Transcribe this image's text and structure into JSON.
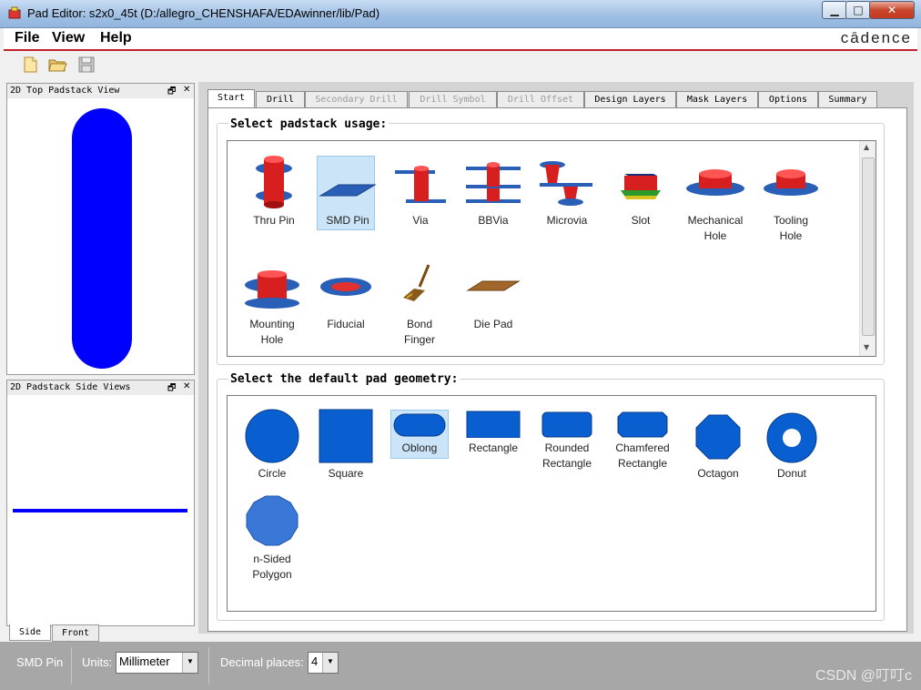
{
  "window": {
    "title": "Pad Editor: s2x0_45t  (D:/allegro_CHENSHAFA/EDAwinner/lib/Pad)",
    "controls": {
      "minimize": "▁",
      "maximize": "□",
      "close": "✕"
    }
  },
  "menubar": {
    "items": [
      {
        "label": "File",
        "icon": "none"
      },
      {
        "label": "View",
        "icon": "none"
      },
      {
        "label": "Help",
        "icon": "none"
      }
    ],
    "brand": "cādence"
  },
  "toolbar": {
    "buttons": [
      {
        "name": "new-file-icon"
      },
      {
        "name": "open-folder-icon"
      },
      {
        "name": "save-icon"
      }
    ]
  },
  "top_view": {
    "title": "2D Top Padstack View",
    "restore": "🗗",
    "close": "✕",
    "shape_color": "#0000ff"
  },
  "side_view": {
    "title": "2D Padstack Side Views",
    "restore": "🗗",
    "close": "✕",
    "line_color": "#0000ff",
    "tabs": [
      "Side",
      "Front"
    ]
  },
  "tabs": [
    {
      "label": "Start",
      "state": "active"
    },
    {
      "label": "Drill",
      "state": "normal"
    },
    {
      "label": "Secondary Drill",
      "state": "disabled"
    },
    {
      "label": "Drill Symbol",
      "state": "disabled"
    },
    {
      "label": "Drill Offset",
      "state": "disabled"
    },
    {
      "label": "Design Layers",
      "state": "normal"
    },
    {
      "label": "Mask Layers",
      "state": "normal"
    },
    {
      "label": "Options",
      "state": "normal"
    },
    {
      "label": "Summary",
      "state": "normal"
    }
  ],
  "usage": {
    "title": "Select padstack usage:",
    "selected": "SMD Pin",
    "items": [
      {
        "line1": "Thru Pin",
        "line2": ""
      },
      {
        "line1": "SMD Pin",
        "line2": ""
      },
      {
        "line1": "Via",
        "line2": ""
      },
      {
        "line1": "BBVia",
        "line2": ""
      },
      {
        "line1": "Microvia",
        "line2": ""
      },
      {
        "line1": "Slot",
        "line2": ""
      },
      {
        "line1": "Mechanical",
        "line2": "Hole"
      },
      {
        "line1": "Tooling",
        "line2": "Hole"
      },
      {
        "line1": "Mounting",
        "line2": "Hole"
      },
      {
        "line1": "Fiducial",
        "line2": ""
      },
      {
        "line1": "Bond",
        "line2": "Finger"
      },
      {
        "line1": "Die Pad",
        "line2": ""
      }
    ]
  },
  "geometry": {
    "title": "Select the default pad geometry:",
    "selected": "Oblong",
    "items": [
      {
        "line1": "Circle",
        "line2": ""
      },
      {
        "line1": "Square",
        "line2": ""
      },
      {
        "line1": "Oblong",
        "line2": ""
      },
      {
        "line1": "Rectangle",
        "line2": ""
      },
      {
        "line1": "Rounded",
        "line2": "Rectangle"
      },
      {
        "line1": "Chamfered",
        "line2": "Rectangle"
      },
      {
        "line1": "Octagon",
        "line2": ""
      },
      {
        "line1": "Donut",
        "line2": ""
      },
      {
        "line1": "n-Sided",
        "line2": "Polygon"
      }
    ]
  },
  "statusbar": {
    "mode": "SMD Pin",
    "units_label": "Units:",
    "units_value": "Millimeter",
    "decimal_label": "Decimal places:",
    "decimal_value": "4",
    "dropdown_arrow": "▼"
  },
  "watermark": "CSDN @叮叮c",
  "colors": {
    "pad_blue": "#2a5fb8",
    "geometry_blue": "#0a5fd0",
    "barrel_red": "#d81f1f",
    "selection": "#cce4f7",
    "menu_accent": "#c8202a"
  }
}
